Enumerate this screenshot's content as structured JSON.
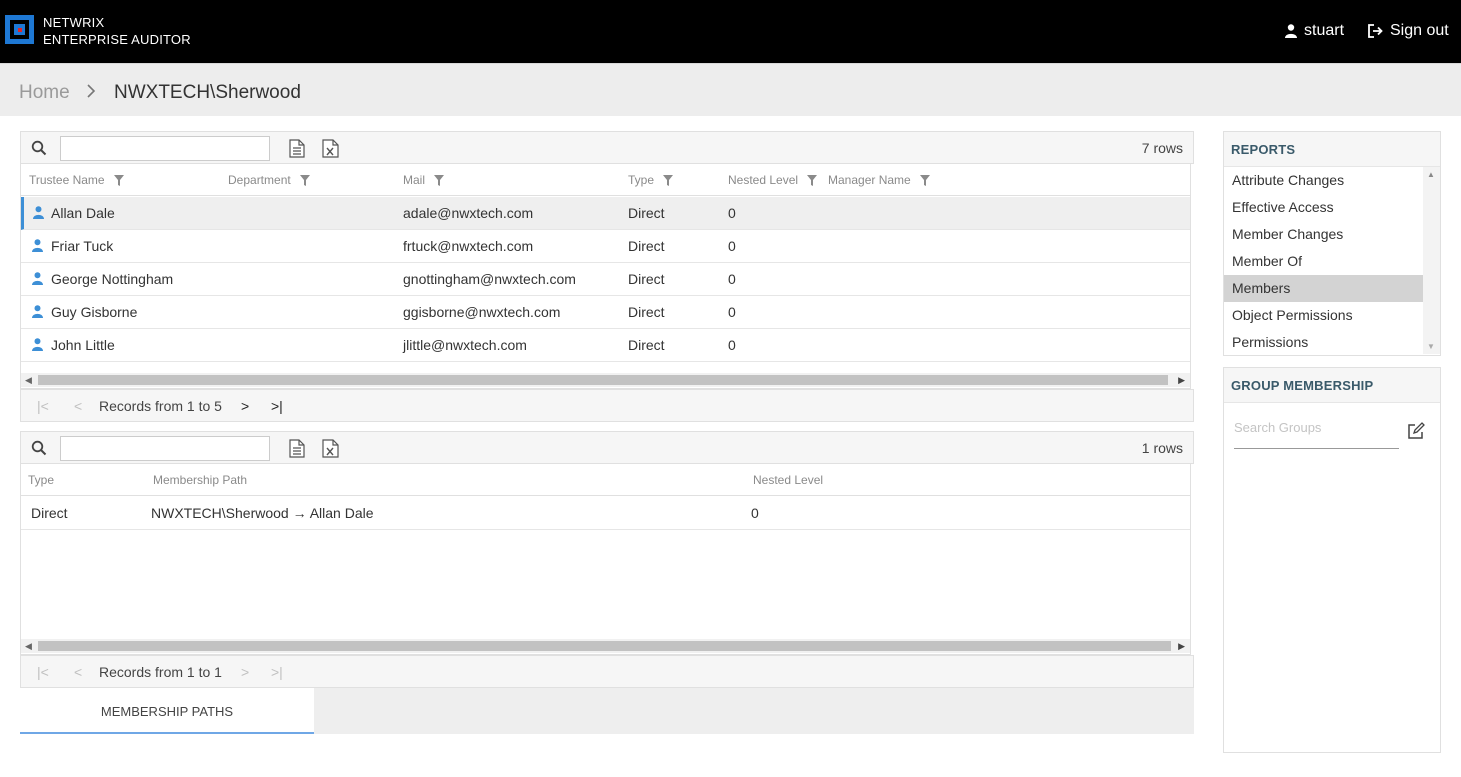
{
  "header": {
    "brand_line1": "NETWRIX",
    "brand_line2": "ENTERPRISE AUDITOR",
    "user": "stuart",
    "signout": "Sign out"
  },
  "breadcrumb": {
    "home": "Home",
    "separator": ">",
    "current": "NWXTECH\\Sherwood"
  },
  "members_grid": {
    "row_count": "7 rows",
    "columns": [
      "Trustee Name",
      "Department",
      "Mail",
      "Type",
      "Nested Level",
      "Manager Name"
    ],
    "rows": [
      {
        "name": "Allan Dale",
        "department": "",
        "mail": "adale@nwxtech.com",
        "type": "Direct",
        "nested": "0",
        "manager": ""
      },
      {
        "name": "Friar Tuck",
        "department": "",
        "mail": "frtuck@nwxtech.com",
        "type": "Direct",
        "nested": "0",
        "manager": ""
      },
      {
        "name": "George Nottingham",
        "department": "",
        "mail": "gnottingham@nwxtech.com",
        "type": "Direct",
        "nested": "0",
        "manager": ""
      },
      {
        "name": "Guy Gisborne",
        "department": "",
        "mail": "ggisborne@nwxtech.com",
        "type": "Direct",
        "nested": "0",
        "manager": ""
      },
      {
        "name": "John Little",
        "department": "",
        "mail": "jlittle@nwxtech.com",
        "type": "Direct",
        "nested": "0",
        "manager": ""
      }
    ],
    "pager_text": "Records from 1 to 5"
  },
  "paths_grid": {
    "row_count": "1 rows",
    "columns": [
      "Type",
      "Membership Path",
      "Nested Level"
    ],
    "rows": [
      {
        "type": "Direct",
        "path": "NWXTECH\\Sherwood → Allan Dale",
        "nested": "0"
      }
    ],
    "pager_text": "Records from 1 to 1"
  },
  "tabs": {
    "membership_paths": "MEMBERSHIP PATHS"
  },
  "reports": {
    "title": "REPORTS",
    "items": [
      "Attribute Changes",
      "Effective Access",
      "Member Changes",
      "Member Of",
      "Members",
      "Object Permissions",
      "Permissions"
    ],
    "active": "Members"
  },
  "group_membership": {
    "title": "GROUP MEMBERSHIP",
    "search_placeholder": "Search Groups"
  },
  "colors": {
    "header_bg": "#000000",
    "accent": "#3d8fd6",
    "selected_row": "#efefef",
    "active_report": "#d3d3d3"
  }
}
